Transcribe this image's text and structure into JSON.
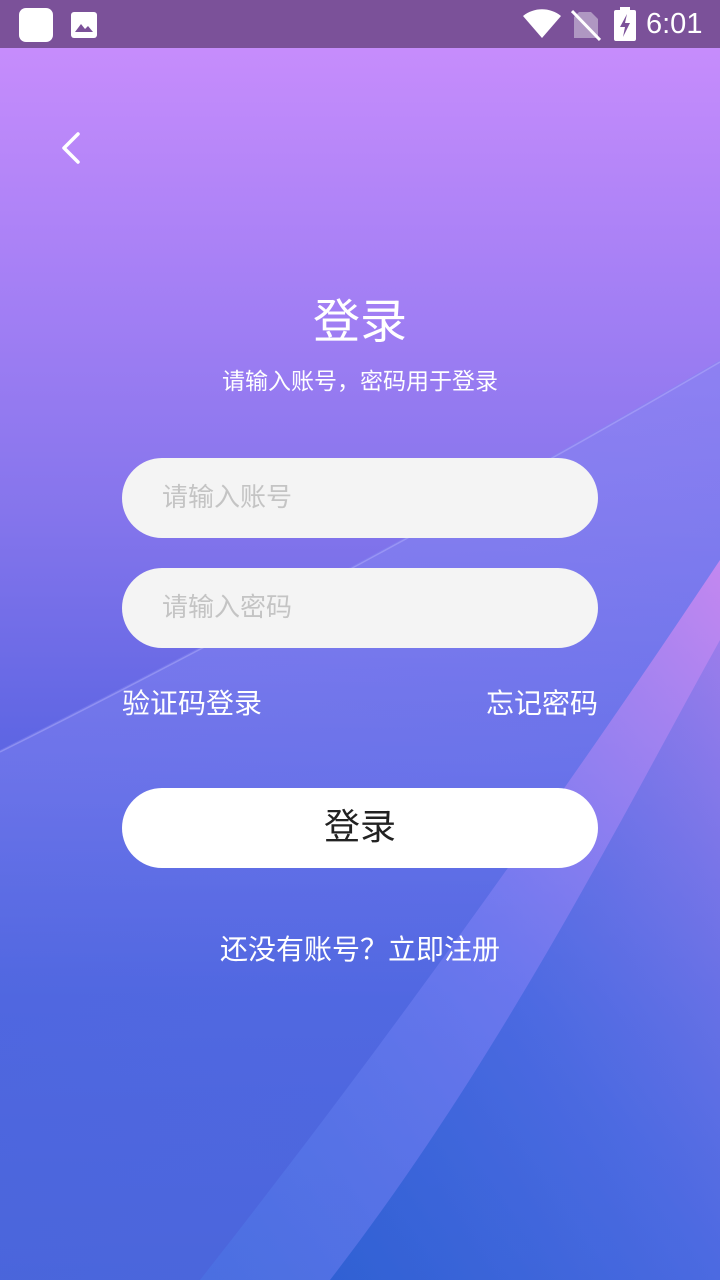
{
  "status_bar": {
    "time": "6:01",
    "icons": [
      "app-icon",
      "image-icon",
      "wifi-icon",
      "no-sim-icon",
      "battery-charging-icon"
    ]
  },
  "header": {
    "back_icon": "chevron-left-icon"
  },
  "login": {
    "title": "登录",
    "subtitle": "请输入账号，密码用于登录",
    "account_placeholder": "请输入账号",
    "account_value": "",
    "password_placeholder": "请输入密码",
    "password_value": "",
    "sms_login_label": "验证码登录",
    "forgot_password_label": "忘记密码",
    "submit_label": "登录",
    "register_prompt": "还没有账号？立即注册"
  },
  "colors": {
    "status_bar": "#7b5199",
    "gradient_top": "#cd8ffd",
    "gradient_bottom": "#1f4bc8",
    "input_background": "#f4f4f4",
    "placeholder_text": "#c4c4c4",
    "button_background": "#ffffff",
    "button_text": "#222222"
  }
}
